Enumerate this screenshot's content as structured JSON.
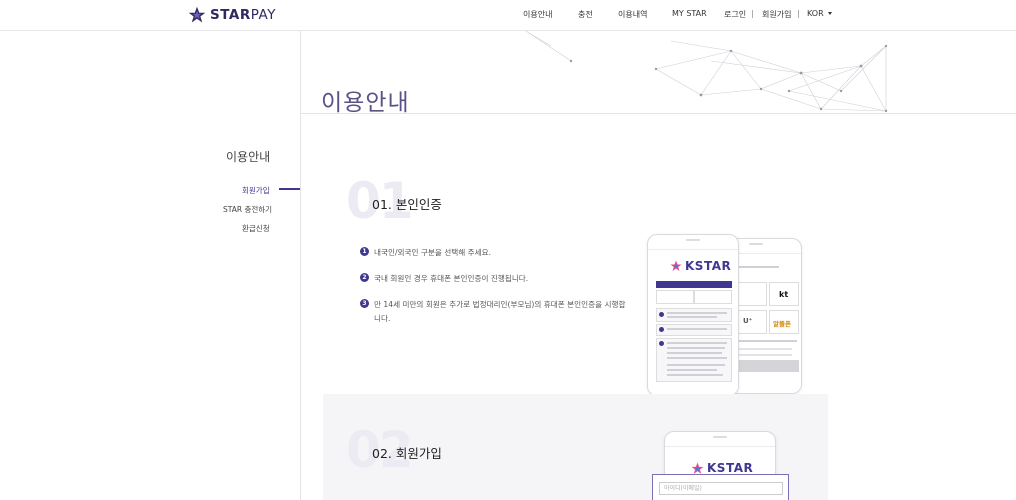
{
  "brand": {
    "logo_text_bold": "STAR",
    "logo_text_thin": "PAY"
  },
  "nav": {
    "guide": "이용안내",
    "charge": "충전",
    "history": "이용내역",
    "mystar": "MY STAR",
    "login": "로그인",
    "sep1": "|",
    "signup": "회원가입",
    "sep2": "|",
    "language": "KOR"
  },
  "hero": {
    "title": "이용안내"
  },
  "sidebar": {
    "title": "이용안내",
    "items": [
      {
        "label": "회원가입",
        "active": true
      },
      {
        "label": "STAR 충전하기",
        "active": false
      },
      {
        "label": "환급신청",
        "active": false
      }
    ]
  },
  "sections": [
    {
      "number": "01",
      "title": "01. 본인인증",
      "steps": [
        {
          "badge": "1",
          "text": "내국인/외국인 구분을 선택해 주세요."
        },
        {
          "badge": "2",
          "text": "국내 회원인 경우 휴대폰 본인인증이 진행됩니다."
        },
        {
          "badge": "3",
          "text": "만 14세 미만의 회원은 추가로 법정대리인(부모님)의 휴대폰 본인인증을 시행합니다."
        }
      ],
      "phone": {
        "brand": "KSTAR",
        "carrier_kt": "kt",
        "carrier_lgu": "U⁺",
        "carrier_mvno": "알뜰폰"
      }
    },
    {
      "number": "02",
      "title": "02. 회원가입",
      "phone": {
        "brand": "KSTAR",
        "input_placeholder": "아이디(이메일)"
      }
    }
  ],
  "colors": {
    "accent": "#3f3790",
    "hero_title": "#5a5287",
    "section_bg": "#f5f5f7"
  }
}
